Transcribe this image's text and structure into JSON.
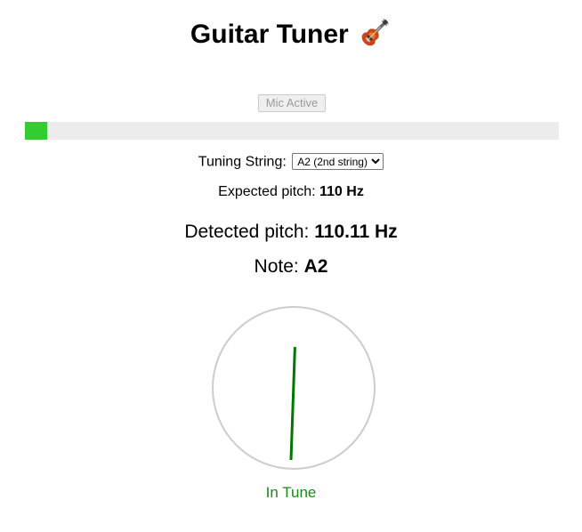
{
  "header": {
    "title": "Guitar Tuner",
    "emoji_icon": "guitar-icon"
  },
  "mic": {
    "button_label": "Mic Active",
    "disabled": true,
    "input_level": 0.042
  },
  "tuning": {
    "label": "Tuning String:",
    "selected": "A2 (2nd string)",
    "options": [
      "A2 (2nd string)"
    ]
  },
  "expected": {
    "label": "Expected pitch:",
    "value": "110 Hz"
  },
  "detected": {
    "label": "Detected pitch:",
    "value": "110.11 Hz"
  },
  "note": {
    "label": "Note:",
    "value": "A2"
  },
  "meter": {
    "needle_angle_deg": 2,
    "needle_color": "#007700",
    "ring_color": "#cccccc"
  },
  "status": {
    "text": "In Tune",
    "color": "#1a8a1a"
  },
  "colors": {
    "level_fill": "#33cc33",
    "level_track": "#ececec"
  }
}
